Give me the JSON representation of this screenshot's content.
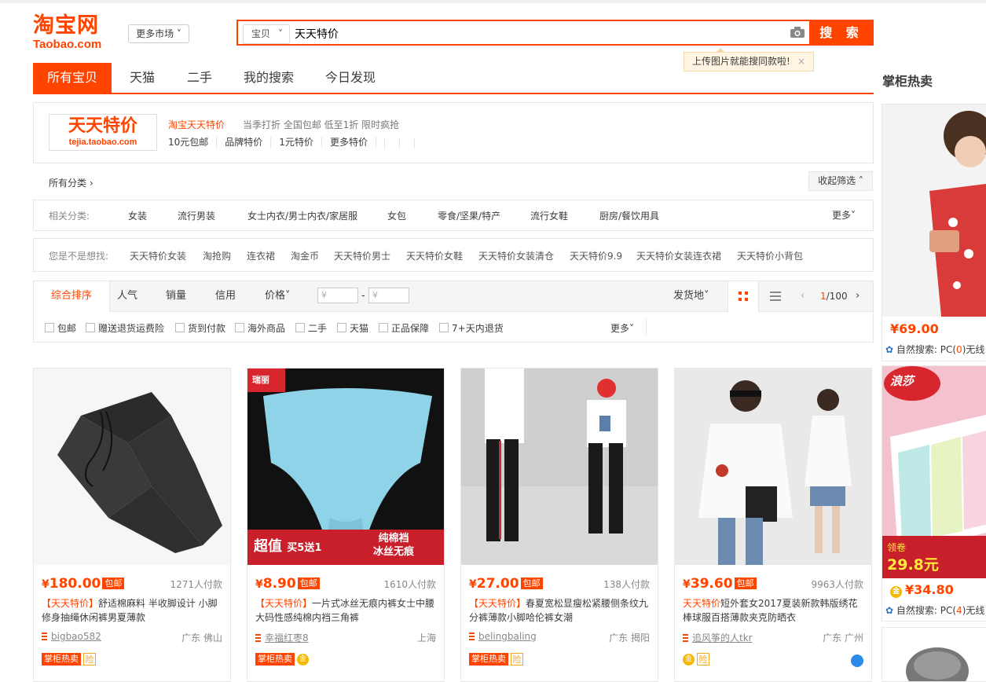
{
  "header": {
    "logo_cn": "淘宝网",
    "logo_en": "Taobao.com",
    "market_label": "更多市场",
    "search_type": "宝贝",
    "search_value": "天天特价",
    "search_button": "搜 索",
    "upload_tip": "上传图片就能搜同款啦!",
    "tip_close": "×"
  },
  "tabs": [
    "所有宝贝",
    "天猫",
    "二手",
    "我的搜索",
    "今日发现"
  ],
  "side_title": "掌柜热卖",
  "promo": {
    "logo_big": "天天特价",
    "logo_small": "tejia.taobao.com",
    "name": "淘宝天天特价",
    "desc": "当季打折 全国包邮 低至1折 限时疯抢",
    "links": [
      "10元包邮",
      "品牌特价",
      "1元特价",
      "更多特价"
    ]
  },
  "all_categories": "所有分类 ›",
  "collapse_label": "收起筛选 ˄",
  "related": {
    "label": "相关分类:",
    "items": [
      "女装",
      "流行男装",
      "女士内衣/男士内衣/家居服",
      "女包",
      "零食/坚果/特产",
      "流行女鞋",
      "厨房/餐饮用具"
    ],
    "more": "更多˅"
  },
  "suggest": {
    "label": "您是不是想找:",
    "items": [
      "天天特价女装",
      "淘抢购",
      "连衣裙",
      "淘金币",
      "天天特价男士",
      "天天特价女鞋",
      "天天特价女装清仓",
      "天天特价9.9",
      "天天特价女装连衣裙",
      "天天特价小背包"
    ]
  },
  "sort": {
    "items": [
      "综合排序",
      "人气",
      "销量",
      "信用",
      "价格˅"
    ],
    "price_placeholder": "¥",
    "ship_from": "发货地˅",
    "page_current": "1",
    "page_total": "/100"
  },
  "checks": [
    "包邮",
    "赠送退货运费险",
    "货到付款",
    "海外商品",
    "二手",
    "天猫",
    "正品保障",
    "7+天内退货"
  ],
  "checks_more": "更多˅",
  "products": [
    {
      "price": "180.00",
      "baoyou": "包邮",
      "deals": "1271人付款",
      "tag": "【天天特价】",
      "title": "舒适棉麻料 半收脚设计 小脚修身抽绳休闲裤男夏薄款",
      "shop": "bigbao582",
      "location": "广东 佛山",
      "badge": "掌柜热卖",
      "icon": "险"
    },
    {
      "price": "8.90",
      "baoyou": "包邮",
      "deals": "1610人付款",
      "tag": "【天天特价】",
      "title": "一片式冰丝无痕内裤女士中腰大码性感纯棉内裆三角裤",
      "shop": "幸福红枣8",
      "location": "上海",
      "badge": "掌柜热卖",
      "icon": "金",
      "img_text1": "超值",
      "img_text2": "买5送1",
      "img_text3": "纯棉裆",
      "img_text4": "冰丝无痕",
      "img_brand": "瑞丽"
    },
    {
      "price": "27.00",
      "baoyou": "包邮",
      "deals": "138人付款",
      "tag": "【天天特价】",
      "title": "春夏宽松显瘦松紧腰侧条纹九分裤薄款小脚哈伦裤女潮",
      "shop": "belingbaling",
      "location": "广东 揭阳",
      "badge": "掌柜热卖",
      "icon": "险"
    },
    {
      "price": "39.60",
      "baoyou": "包邮",
      "deals": "9963人付款",
      "tag": "天天特价",
      "title": "短外套女2017夏装新款韩版绣花棒球服百搭薄款夹克防晒衣",
      "shop": "追风筝的人tkr",
      "location": "广东 广州",
      "badge": "",
      "icon": "险"
    }
  ],
  "side_cards": [
    {
      "price": "¥69.00",
      "search_prefix": "自然搜索: PC(",
      "search_num": "0",
      "search_suffix": ")无线"
    },
    {
      "price": "¥34.80",
      "search_prefix": "自然搜索: PC(",
      "search_num": "4",
      "search_suffix": ")无线",
      "img_brand": "浪莎",
      "coupon_label": "领卷",
      "coupon_value": "29.8元"
    }
  ],
  "colors": {
    "accent": "#ff4400",
    "border": "#e6e6e6"
  }
}
